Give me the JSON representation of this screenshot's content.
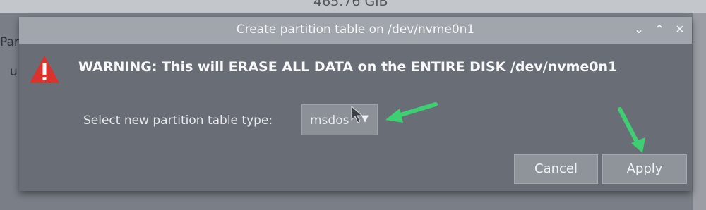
{
  "background": {
    "capacity_text": "465.76 GiB",
    "left_label_1": "Par",
    "left_label_2": "u"
  },
  "dialog": {
    "title": "Create partition table on /dev/nvme0n1",
    "titlebar_buttons": [
      {
        "name": "minimize",
        "glyph": "⌄"
      },
      {
        "name": "maximize",
        "glyph": "⌃"
      },
      {
        "name": "close",
        "glyph": "✕"
      }
    ],
    "warning_text": "WARNING:  This will ERASE ALL DATA on the ENTIRE DISK /dev/nvme0n1",
    "table_type_label": "Select new partition table type:",
    "table_type_value": "msdos",
    "cancel_label": "Cancel",
    "apply_label": "Apply"
  },
  "colors": {
    "dialog_body": "#696e76",
    "titlebar": "#a1a6ad",
    "warning_icon": "#d9332b",
    "annotation_arrow": "#3fcf73"
  },
  "icons": {
    "warning": "warning-triangle-icon",
    "dropdown": "chevron-down-icon",
    "cursor": "mouse-pointer-icon"
  }
}
